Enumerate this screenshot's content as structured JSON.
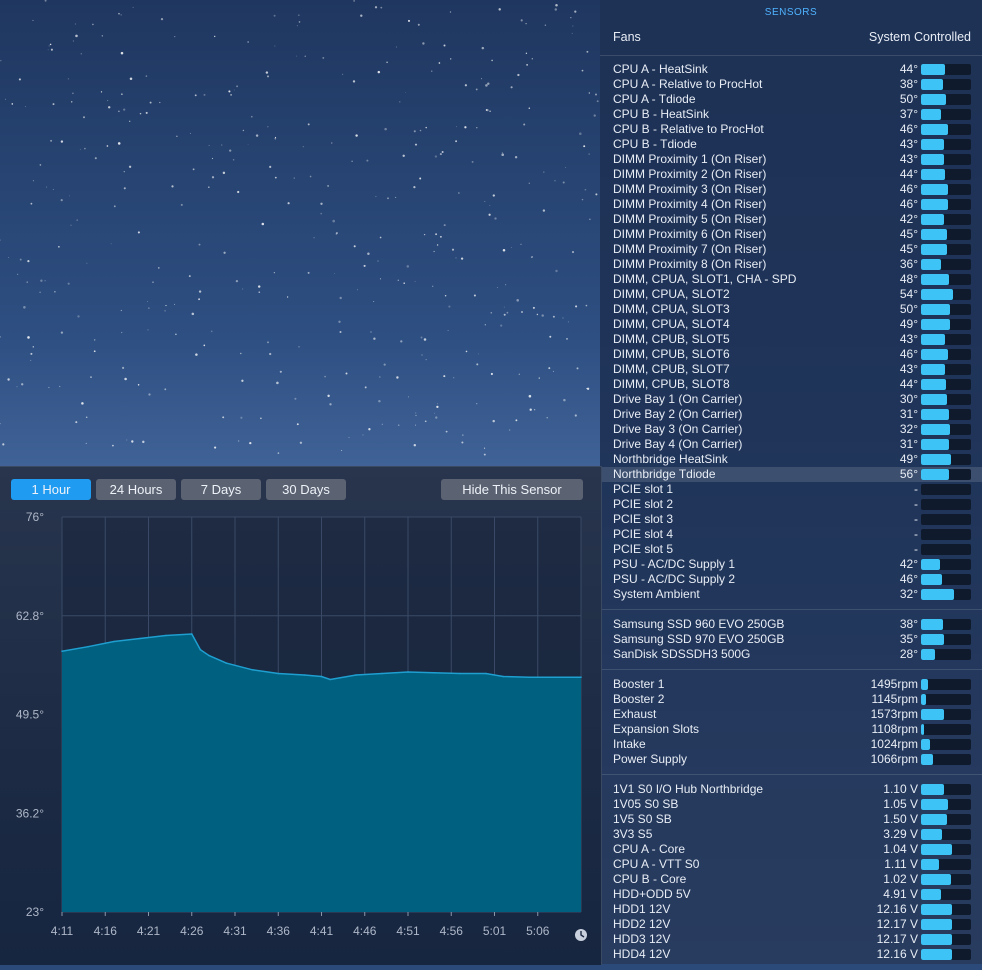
{
  "panel_title": "SENSORS",
  "fans_header": {
    "label": "Fans",
    "value": "System Controlled"
  },
  "temperature_sensors": [
    {
      "name": "CPU A - HeatSink",
      "value": "44°",
      "level": 0.48
    },
    {
      "name": "CPU A - Relative to ProcHot",
      "value": "38°",
      "level": 0.44
    },
    {
      "name": "CPU A - Tdiode",
      "value": "50°",
      "level": 0.5
    },
    {
      "name": "CPU B - HeatSink",
      "value": "37°",
      "level": 0.4
    },
    {
      "name": "CPU B - Relative to ProcHot",
      "value": "46°",
      "level": 0.54
    },
    {
      "name": "CPU B - Tdiode",
      "value": "43°",
      "level": 0.46
    },
    {
      "name": "DIMM Proximity 1 (On Riser)",
      "value": "43°",
      "level": 0.46
    },
    {
      "name": "DIMM Proximity 2 (On Riser)",
      "value": "44°",
      "level": 0.48
    },
    {
      "name": "DIMM Proximity 3 (On Riser)",
      "value": "46°",
      "level": 0.54
    },
    {
      "name": "DIMM Proximity 4 (On Riser)",
      "value": "46°",
      "level": 0.54
    },
    {
      "name": "DIMM Proximity 5 (On Riser)",
      "value": "42°",
      "level": 0.46
    },
    {
      "name": "DIMM Proximity 6 (On Riser)",
      "value": "45°",
      "level": 0.52
    },
    {
      "name": "DIMM Proximity 7 (On Riser)",
      "value": "45°",
      "level": 0.52
    },
    {
      "name": "DIMM Proximity 8 (On Riser)",
      "value": "36°",
      "level": 0.4
    },
    {
      "name": "DIMM, CPUA, SLOT1, CHA - SPD",
      "value": "48°",
      "level": 0.56
    },
    {
      "name": "DIMM, CPUA, SLOT2",
      "value": "54°",
      "level": 0.64
    },
    {
      "name": "DIMM, CPUA, SLOT3",
      "value": "50°",
      "level": 0.58
    },
    {
      "name": "DIMM, CPUA, SLOT4",
      "value": "49°",
      "level": 0.57
    },
    {
      "name": "DIMM, CPUB, SLOT5",
      "value": "43°",
      "level": 0.48
    },
    {
      "name": "DIMM, CPUB, SLOT6",
      "value": "46°",
      "level": 0.54
    },
    {
      "name": "DIMM, CPUB, SLOT7",
      "value": "43°",
      "level": 0.48
    },
    {
      "name": "DIMM, CPUB, SLOT8",
      "value": "44°",
      "level": 0.5
    },
    {
      "name": "Drive Bay 1 (On Carrier)",
      "value": "30°",
      "level": 0.52
    },
    {
      "name": "Drive Bay 2 (On Carrier)",
      "value": "31°",
      "level": 0.56
    },
    {
      "name": "Drive Bay 3 (On Carrier)",
      "value": "32°",
      "level": 0.58
    },
    {
      "name": "Drive Bay 4 (On Carrier)",
      "value": "31°",
      "level": 0.56
    },
    {
      "name": "Northbridge HeatSink",
      "value": "49°",
      "level": 0.6
    },
    {
      "name": "Northbridge Tdiode",
      "value": "56°",
      "level": 0.56,
      "selected": true
    },
    {
      "name": "PCIE slot 1",
      "value": "-",
      "level": 0
    },
    {
      "name": "PCIE slot 2",
      "value": "-",
      "level": 0
    },
    {
      "name": "PCIE slot 3",
      "value": "-",
      "level": 0
    },
    {
      "name": "PCIE slot 4",
      "value": "-",
      "level": 0
    },
    {
      "name": "PCIE slot 5",
      "value": "-",
      "level": 0
    },
    {
      "name": "PSU - AC/DC Supply 1",
      "value": "42°",
      "level": 0.38
    },
    {
      "name": "PSU - AC/DC Supply 2",
      "value": "46°",
      "level": 0.42
    },
    {
      "name": "System Ambient",
      "value": "32°",
      "level": 0.66
    }
  ],
  "drive_sensors": [
    {
      "name": "Samsung SSD 960 EVO 250GB",
      "value": "38°",
      "level": 0.44
    },
    {
      "name": "Samsung SSD 970 EVO 250GB",
      "value": "35°",
      "level": 0.46
    },
    {
      "name": "SanDisk SDSSDH3 500G",
      "value": "28°",
      "level": 0.28
    }
  ],
  "fan_sensors": [
    {
      "name": "Booster 1",
      "value": "1495rpm",
      "level": 0.14
    },
    {
      "name": "Booster 2",
      "value": "1145rpm",
      "level": 0.1
    },
    {
      "name": "Exhaust",
      "value": "1573rpm",
      "level": 0.46
    },
    {
      "name": "Expansion Slots",
      "value": "1108rpm",
      "level": 0.06
    },
    {
      "name": "Intake",
      "value": "1024rpm",
      "level": 0.18
    },
    {
      "name": "Power Supply",
      "value": "1066rpm",
      "level": 0.24
    }
  ],
  "voltage_sensors": [
    {
      "name": "1V1 S0 I/O Hub Northbridge",
      "value": "1.10 V",
      "level": 0.46
    },
    {
      "name": "1V05 S0 SB",
      "value": "1.05 V",
      "level": 0.54
    },
    {
      "name": "1V5 S0 SB",
      "value": "1.50 V",
      "level": 0.52
    },
    {
      "name": "3V3 S5",
      "value": "3.29 V",
      "level": 0.42
    },
    {
      "name": "CPU A - Core",
      "value": "1.04 V",
      "level": 0.62
    },
    {
      "name": "CPU A - VTT S0",
      "value": "1.11 V",
      "level": 0.36
    },
    {
      "name": "CPU B - Core",
      "value": "1.02 V",
      "level": 0.6
    },
    {
      "name": "HDD+ODD 5V",
      "value": "4.91 V",
      "level": 0.4
    },
    {
      "name": "HDD1 12V",
      "value": "12.16 V",
      "level": 0.62
    },
    {
      "name": "HDD2 12V",
      "value": "12.17 V",
      "level": 0.62
    },
    {
      "name": "HDD3 12V",
      "value": "12.17 V",
      "level": 0.62
    },
    {
      "name": "HDD4 12V",
      "value": "12.16 V",
      "level": 0.62
    }
  ],
  "colors": {
    "accent": "#1f9bf1",
    "bar_fill": "#3dc3f5",
    "panel_title": "#4fb3ff",
    "graph_fill": "#00607f",
    "graph_line": "#1e9fd0"
  },
  "graph": {
    "range_buttons": [
      {
        "label": "1 Hour",
        "active": true
      },
      {
        "label": "24 Hours",
        "active": false
      },
      {
        "label": "7 Days",
        "active": false
      },
      {
        "label": "30 Days",
        "active": false
      }
    ],
    "hide_button": "Hide This Sensor",
    "clock_icon": "clock-icon"
  },
  "chart_data": {
    "type": "area",
    "title": "",
    "xlabel": "",
    "ylabel": "",
    "ylim": [
      23,
      76
    ],
    "y_ticks": [
      "76°",
      "62.8°",
      "49.5°",
      "36.2°",
      "23°"
    ],
    "x_ticks": [
      "4:11",
      "4:16",
      "4:21",
      "4:26",
      "4:31",
      "4:36",
      "4:41",
      "4:46",
      "4:51",
      "4:56",
      "5:01",
      "5:06"
    ],
    "grid": true,
    "series": [
      {
        "x": [
          "4:11",
          "4:14",
          "4:17",
          "4:20",
          "4:23",
          "4:26",
          "4:27",
          "4:28",
          "4:30",
          "4:33",
          "4:36",
          "4:39",
          "4:41",
          "4:42",
          "4:45",
          "4:48",
          "4:51",
          "4:54",
          "4:57",
          "5:00",
          "5:02",
          "5:05",
          "5:08",
          "5:11"
        ],
        "y": [
          58.0,
          58.6,
          59.3,
          59.7,
          60.1,
          60.3,
          58.2,
          57.4,
          56.4,
          55.5,
          55.0,
          54.8,
          54.6,
          54.2,
          54.8,
          55.0,
          55.2,
          55.1,
          55.0,
          55.0,
          54.6,
          54.5,
          54.5,
          54.5
        ]
      }
    ]
  }
}
